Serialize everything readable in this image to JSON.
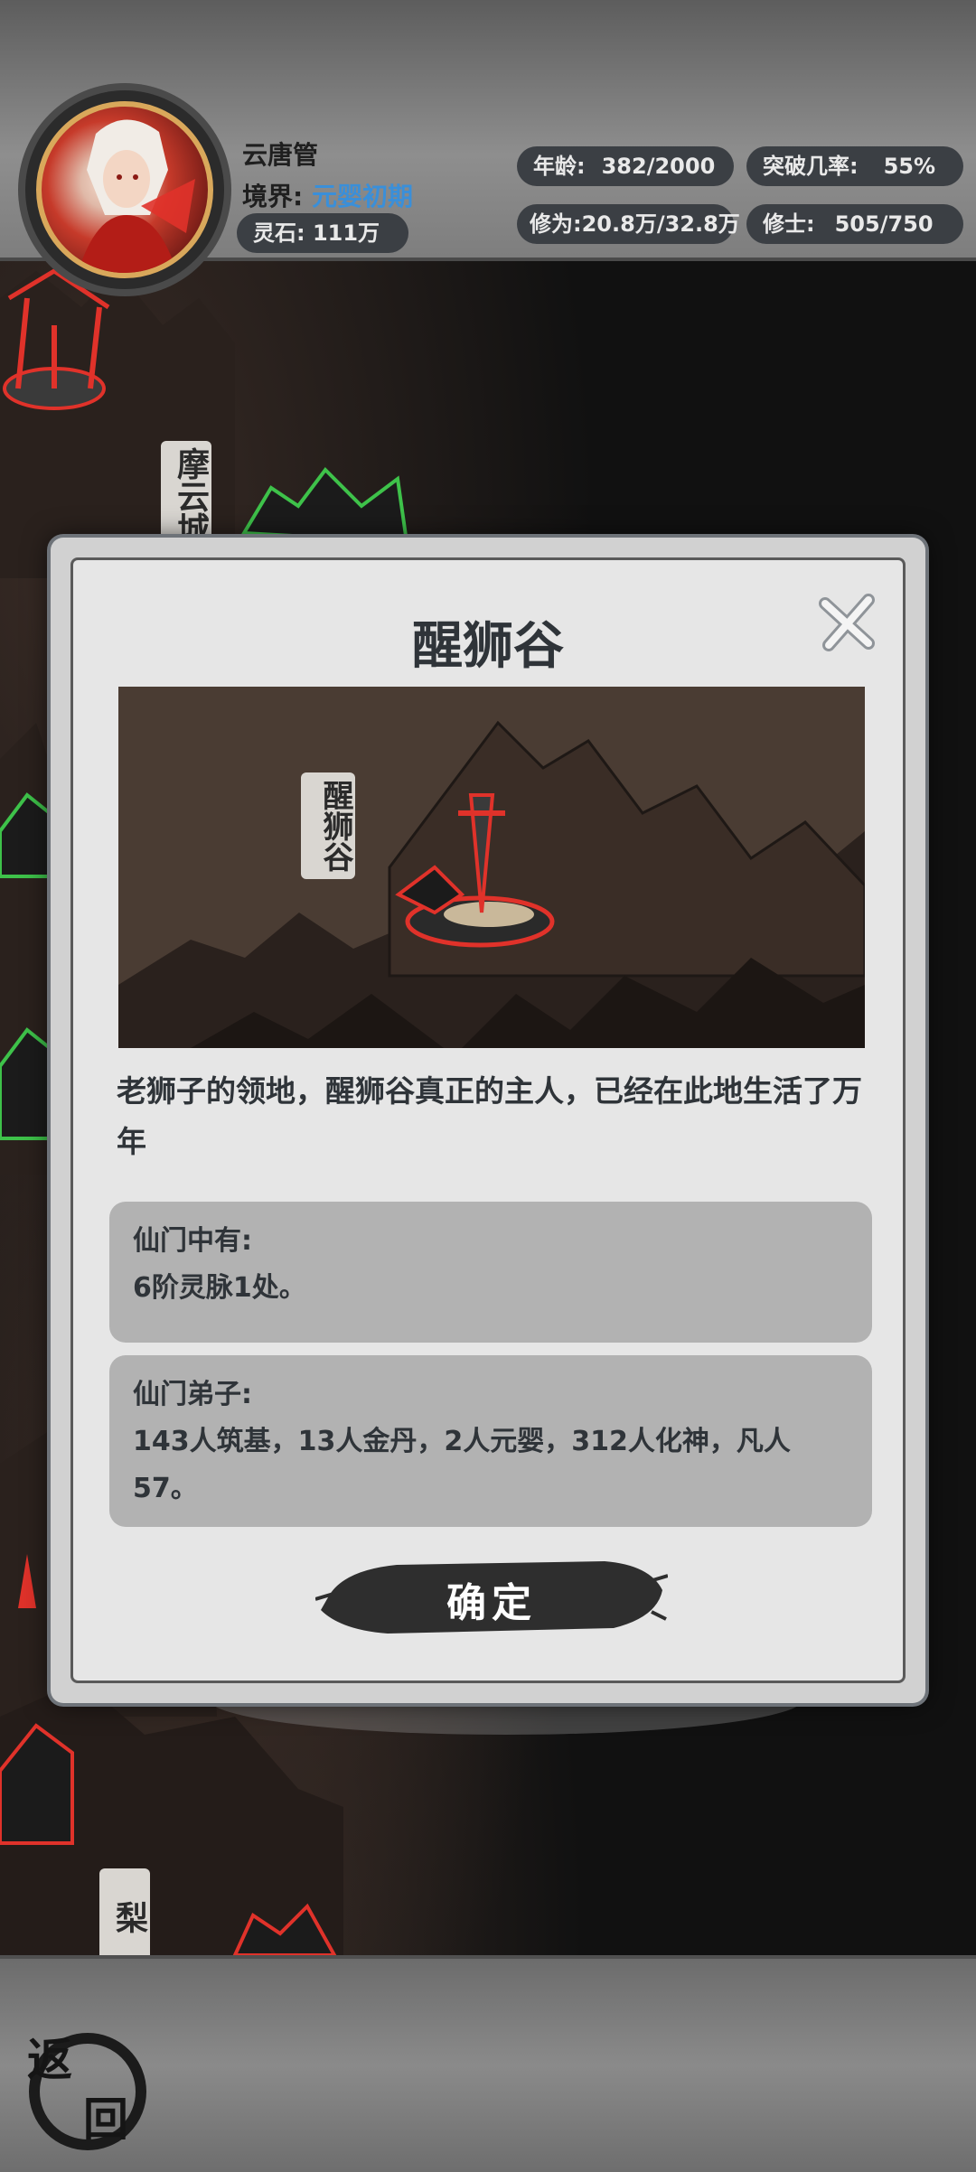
{
  "player": {
    "name": "云唐管",
    "realm_label": "境界:",
    "realm_value": "元婴初期",
    "spirit_stone": "灵石: 111万",
    "age_label": "年龄:",
    "age_value": "382/2000",
    "breakthrough_label": "突破几率:",
    "breakthrough_value": "55%",
    "cultivation_label": "修为:",
    "cultivation_value": "20.8万/32.8万",
    "cultivator_label": "修士:",
    "cultivator_value": "505/750"
  },
  "map": {
    "labels": [
      "摩云城",
      "梨"
    ]
  },
  "modal": {
    "title": "醒狮谷",
    "scene_label": "醒狮谷",
    "description": "老狮子的领地，醒狮谷真正的主人，已经在此地生活了万年",
    "sect_resources_title": "仙门中有:",
    "sect_resources_value": "6阶灵脉1处。",
    "sect_disciples_title": "仙门弟子:",
    "sect_disciples_value": "143人筑基，13人金丹，2人元婴，312人化神，凡人57。",
    "confirm_label": "确定",
    "close_icon": "close-icon"
  },
  "footer": {
    "back_char_1": "返",
    "back_char_2": "回"
  },
  "colors": {
    "realm_accent": "#3a8fd9",
    "pill_bg": "#3b3f44",
    "modal_bg": "#e6e6e6",
    "info_box_bg": "#b2b2b2",
    "scene_bg": "#4a3c33",
    "glow_red": "#e0322a"
  }
}
